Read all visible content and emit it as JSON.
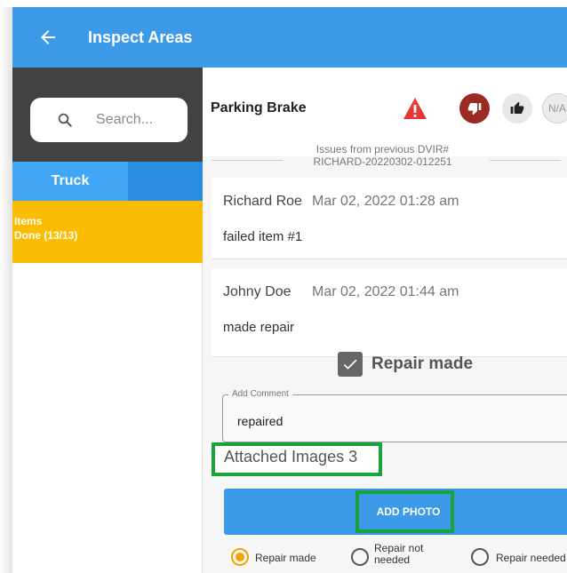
{
  "appbar": {
    "title": "Inspect Areas",
    "back_icon": "arrow-left-icon",
    "color": "#3d9ae8"
  },
  "sidebar": {
    "search_placeholder": "Search...",
    "tab": "Truck",
    "items": {
      "title": "Items",
      "done": "Done (13/13)",
      "color": "#fbbc04"
    }
  },
  "item": {
    "title": "Parking Brake",
    "na_label": "N/A",
    "previous_label": "Issues from previous DVIR#",
    "previous_id": "RICHARD-20220302-012251"
  },
  "comments": [
    {
      "author": "Richard Roe",
      "date": "Mar 02, 2022 01:28 am",
      "text": "failed item #1"
    },
    {
      "author": "Johny Doe",
      "date": "Mar 02, 2022 01:44 am",
      "text": "made repair"
    }
  ],
  "repair_checkbox": {
    "label": "Repair made",
    "checked": true
  },
  "add_comment": {
    "label": "Add Comment",
    "value": "repaired"
  },
  "attached_images": "Attached Images 3",
  "add_photo": "ADD PHOTO",
  "radios": [
    {
      "label": "Repair made",
      "checked": true
    },
    {
      "label": "Repair not needed",
      "checked": false
    },
    {
      "label": "Repair needed",
      "checked": false
    }
  ],
  "colors": {
    "highlight": "#19a33a",
    "fail": "#9b2a22",
    "warning": "#e53935"
  }
}
